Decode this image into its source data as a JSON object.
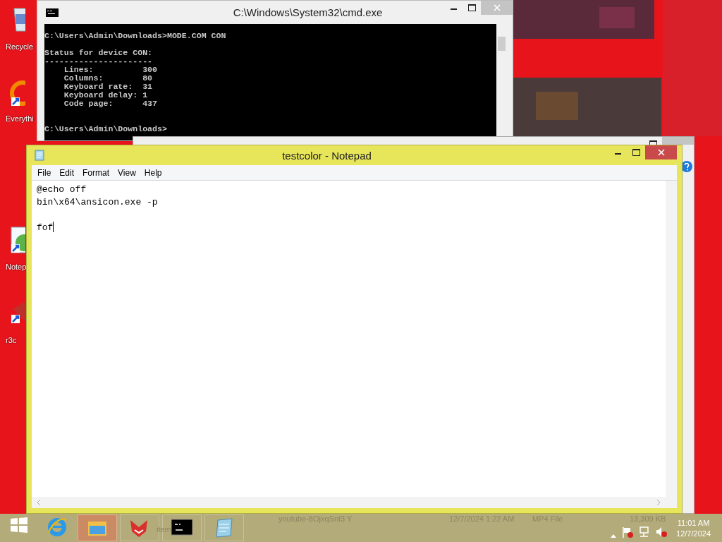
{
  "desktop": {
    "icons": [
      {
        "kind": "recycle",
        "label": "Recycle"
      },
      {
        "kind": "everything",
        "label": "Everythi"
      },
      {
        "kind": "notepad",
        "label": "Notep"
      },
      {
        "kind": "app",
        "label": "r3c"
      }
    ]
  },
  "cmd_window": {
    "title": "C:\\Windows\\System32\\cmd.exe",
    "output": "C:\\Users\\Admin\\Downloads>MODE.COM CON\n\nStatus for device CON:\n----------------------\n    Lines:          300\n    Columns:        80\n    Keyboard rate:  31\n    Keyboard delay: 1\n    Code page:      437\n\n\nC:\\Users\\Admin\\Downloads>"
  },
  "notepad": {
    "title": "testcolor - Notepad",
    "menu": [
      "File",
      "Edit",
      "Format",
      "View",
      "Help"
    ],
    "content": "@echo off\nbin\\x64\\ansicon.exe -p\n\nfof"
  },
  "taskbar": {
    "buttons": [
      {
        "kind": "start",
        "selected": false
      },
      {
        "kind": "browser",
        "selected": false
      },
      {
        "kind": "explorer",
        "selected": true
      },
      {
        "kind": "fox",
        "selected": false
      },
      {
        "kind": "cmd",
        "selected": false
      },
      {
        "kind": "notepad",
        "selected": false
      }
    ],
    "ghost_texts": [
      "item",
      "youtube-8OjxqSnt3 Y",
      "12/7/2024 1:22 AM",
      "MP4 File",
      "13,309 KB"
    ],
    "clock": {
      "time": "11:01 AM",
      "date": "12/7/2024"
    }
  }
}
